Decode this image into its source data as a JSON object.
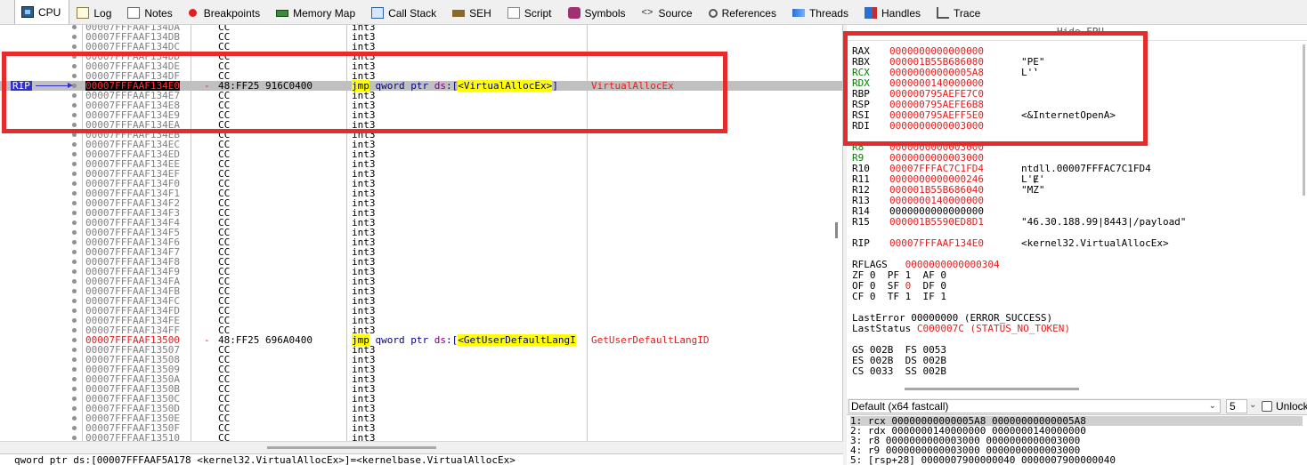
{
  "tabs": [
    {
      "label": "CPU",
      "icon": "cpu-icon",
      "active": true
    },
    {
      "label": "Log",
      "icon": "log-icon"
    },
    {
      "label": "Notes",
      "icon": "notes-icon"
    },
    {
      "label": "Breakpoints",
      "icon": "breakpoint-icon"
    },
    {
      "label": "Memory Map",
      "icon": "memory-map-icon"
    },
    {
      "label": "Call Stack",
      "icon": "call-stack-icon"
    },
    {
      "label": "SEH",
      "icon": "seh-icon"
    },
    {
      "label": "Script",
      "icon": "script-icon"
    },
    {
      "label": "Symbols",
      "icon": "symbols-icon"
    },
    {
      "label": "Source",
      "icon": "source-icon"
    },
    {
      "label": "References",
      "icon": "references-icon"
    },
    {
      "label": "Threads",
      "icon": "threads-icon"
    },
    {
      "label": "Handles",
      "icon": "handles-icon"
    },
    {
      "label": "Trace",
      "icon": "trace-icon"
    }
  ],
  "disasm": {
    "rip_label": "RIP",
    "rows": [
      {
        "addr": "00007FFFAAF134DA",
        "bytes": "CC",
        "instr": "int3"
      },
      {
        "addr": "00007FFFAAF134DB",
        "bytes": "CC",
        "instr": "int3"
      },
      {
        "addr": "00007FFFAAF134DC",
        "bytes": "CC",
        "instr": "int3"
      },
      {
        "addr": "00007FFFAAF134DD",
        "bytes": "CC",
        "instr": "int3"
      },
      {
        "addr": "00007FFFAAF134DE",
        "bytes": "CC",
        "instr": "int3"
      },
      {
        "addr": "00007FFFAAF134DF",
        "bytes": "CC",
        "instr": "int3"
      },
      {
        "addr": "00007FFFAAF134E0",
        "bytes": "48:FF25 916C0400",
        "mnem": "jmp",
        "op1": " qword ptr ",
        "seg": "ds",
        "op2": ":[",
        "target": "<VirtualAllocEx>",
        "op3": "]",
        "comment": "VirtualAllocEx",
        "current": true,
        "dash": "-"
      },
      {
        "addr": "00007FFFAAF134E7",
        "bytes": "CC",
        "instr": "int3"
      },
      {
        "addr": "00007FFFAAF134E8",
        "bytes": "CC",
        "instr": "int3"
      },
      {
        "addr": "00007FFFAAF134E9",
        "bytes": "CC",
        "instr": "int3"
      },
      {
        "addr": "00007FFFAAF134EA",
        "bytes": "CC",
        "instr": "int3"
      },
      {
        "addr": "00007FFFAAF134EB",
        "bytes": "CC",
        "instr": "int3"
      },
      {
        "addr": "00007FFFAAF134EC",
        "bytes": "CC",
        "instr": "int3"
      },
      {
        "addr": "00007FFFAAF134ED",
        "bytes": "CC",
        "instr": "int3"
      },
      {
        "addr": "00007FFFAAF134EE",
        "bytes": "CC",
        "instr": "int3"
      },
      {
        "addr": "00007FFFAAF134EF",
        "bytes": "CC",
        "instr": "int3"
      },
      {
        "addr": "00007FFFAAF134F0",
        "bytes": "CC",
        "instr": "int3"
      },
      {
        "addr": "00007FFFAAF134F1",
        "bytes": "CC",
        "instr": "int3"
      },
      {
        "addr": "00007FFFAAF134F2",
        "bytes": "CC",
        "instr": "int3"
      },
      {
        "addr": "00007FFFAAF134F3",
        "bytes": "CC",
        "instr": "int3"
      },
      {
        "addr": "00007FFFAAF134F4",
        "bytes": "CC",
        "instr": "int3"
      },
      {
        "addr": "00007FFFAAF134F5",
        "bytes": "CC",
        "instr": "int3"
      },
      {
        "addr": "00007FFFAAF134F6",
        "bytes": "CC",
        "instr": "int3"
      },
      {
        "addr": "00007FFFAAF134F7",
        "bytes": "CC",
        "instr": "int3"
      },
      {
        "addr": "00007FFFAAF134F8",
        "bytes": "CC",
        "instr": "int3"
      },
      {
        "addr": "00007FFFAAF134F9",
        "bytes": "CC",
        "instr": "int3"
      },
      {
        "addr": "00007FFFAAF134FA",
        "bytes": "CC",
        "instr": "int3"
      },
      {
        "addr": "00007FFFAAF134FB",
        "bytes": "CC",
        "instr": "int3"
      },
      {
        "addr": "00007FFFAAF134FC",
        "bytes": "CC",
        "instr": "int3"
      },
      {
        "addr": "00007FFFAAF134FD",
        "bytes": "CC",
        "instr": "int3"
      },
      {
        "addr": "00007FFFAAF134FE",
        "bytes": "CC",
        "instr": "int3"
      },
      {
        "addr": "00007FFFAAF134FF",
        "bytes": "CC",
        "instr": "int3"
      },
      {
        "addr": "00007FFFAAF13500",
        "bytes": "48:FF25 696A0400",
        "mnem": "jmp",
        "op1": " qword ptr ",
        "seg": "ds",
        "op2": ":[",
        "target": "<GetUserDefaultLangI",
        "op3": "",
        "comment": "GetUserDefaultLangID",
        "highlight": true,
        "dash": "-"
      },
      {
        "addr": "00007FFFAAF13507",
        "bytes": "CC",
        "instr": "int3"
      },
      {
        "addr": "00007FFFAAF13508",
        "bytes": "CC",
        "instr": "int3"
      },
      {
        "addr": "00007FFFAAF13509",
        "bytes": "CC",
        "instr": "int3"
      },
      {
        "addr": "00007FFFAAF1350A",
        "bytes": "CC",
        "instr": "int3"
      },
      {
        "addr": "00007FFFAAF1350B",
        "bytes": "CC",
        "instr": "int3"
      },
      {
        "addr": "00007FFFAAF1350C",
        "bytes": "CC",
        "instr": "int3"
      },
      {
        "addr": "00007FFFAAF1350D",
        "bytes": "CC",
        "instr": "int3"
      },
      {
        "addr": "00007FFFAAF1350E",
        "bytes": "CC",
        "instr": "int3"
      },
      {
        "addr": "00007FFFAAF1350F",
        "bytes": "CC",
        "instr": "int3"
      },
      {
        "addr": "00007FFFAAF13510",
        "bytes": "CC",
        "instr": "int3"
      }
    ]
  },
  "info_line": "qword ptr ds:[00007FFFAAF5A178 <kernel32.VirtualAllocEx>]=<kernelbase.VirtualAllocEx>",
  "registers": {
    "header": "Hide FPU",
    "general": [
      {
        "name": "RAX",
        "value": "0000000000000000",
        "note": ""
      },
      {
        "name": "RBX",
        "value": "000001B55B686080",
        "note": "\"PE\""
      },
      {
        "name": "RCX",
        "value": "00000000000005A8",
        "note": "L'̀'",
        "changed": true
      },
      {
        "name": "RDX",
        "value": "0000000140000000",
        "note": "",
        "changed": true
      },
      {
        "name": "RBP",
        "value": "000000795AEFE7C0",
        "note": ""
      },
      {
        "name": "RSP",
        "value": "000000795AEFE6B8",
        "note": ""
      },
      {
        "name": "RSI",
        "value": "000000795AEFF5E0",
        "note": "<&InternetOpenA>"
      },
      {
        "name": "RDI",
        "value": "0000000000003000",
        "note": ""
      }
    ],
    "extended": [
      {
        "name": "R8",
        "value": "0000000000003000",
        "note": "",
        "changed": true
      },
      {
        "name": "R9",
        "value": "0000000000003000",
        "note": "",
        "changed": true
      },
      {
        "name": "R10",
        "value": "00007FFFAC7C1FD4",
        "note": "ntdll.00007FFFAC7C1FD4"
      },
      {
        "name": "R11",
        "value": "0000000000000246",
        "note": "L'Ɇ'"
      },
      {
        "name": "R12",
        "value": "000001B55B686040",
        "note": "\"MZ\""
      },
      {
        "name": "R13",
        "value": "0000000140000000",
        "note": ""
      },
      {
        "name": "R14",
        "value": "0000000000000000",
        "note": "",
        "black": true
      },
      {
        "name": "R15",
        "value": "000001B5590ED8D1",
        "note": "\"46.30.188.99|8443|/payload\""
      }
    ],
    "rip": {
      "name": "RIP",
      "value": "00007FFFAAF134E0",
      "note": "<kernel32.VirtualAllocEx>"
    },
    "rflags": {
      "name": "RFLAGS",
      "value": "0000000000000304"
    },
    "flags": [
      [
        {
          "n": "ZF",
          "v": "0"
        },
        {
          "n": "PF",
          "v": "1"
        },
        {
          "n": "AF",
          "v": "0"
        }
      ],
      [
        {
          "n": "OF",
          "v": "0"
        },
        {
          "n": "SF",
          "v": "0",
          "red": true
        },
        {
          "n": "DF",
          "v": "0"
        }
      ],
      [
        {
          "n": "CF",
          "v": "0"
        },
        {
          "n": "TF",
          "v": "1"
        },
        {
          "n": "IF",
          "v": "1"
        }
      ]
    ],
    "last_error": {
      "label": "LastError",
      "value": "00000000",
      "note": "(ERROR_SUCCESS)"
    },
    "last_status": {
      "label": "LastStatus",
      "value": "C000007C",
      "note": "(STATUS_NO_TOKEN)"
    },
    "segments": [
      [
        {
          "n": "GS",
          "v": "002B"
        },
        {
          "n": "FS",
          "v": "0053"
        }
      ],
      [
        {
          "n": "ES",
          "v": "002B"
        },
        {
          "n": "DS",
          "v": "002B"
        }
      ],
      [
        {
          "n": "CS",
          "v": "0033"
        },
        {
          "n": "SS",
          "v": "002B"
        }
      ]
    ]
  },
  "callconv": {
    "selected": "Default (x64 fastcall)",
    "arg_count": "5",
    "unlock_label": "Unlocked"
  },
  "args": [
    "1: rcx 00000000000005A8 00000000000005A8",
    "2: rdx 0000000140000000 0000000140000000",
    "3: r8 0000000000003000 0000000000003000",
    "4: r9 0000000000003000 0000000000003000",
    "5: [rsp+28] 0000007900000040 0000007900000040"
  ],
  "colors": {
    "annotation": "#e52b2b",
    "rip_marker": "#3030d0",
    "changed_register": "#008000"
  }
}
